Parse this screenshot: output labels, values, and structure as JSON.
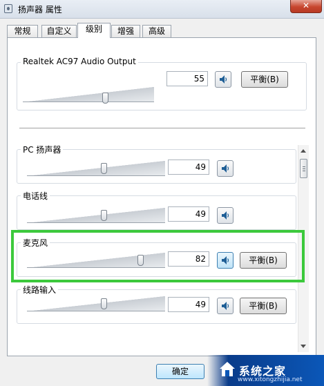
{
  "window": {
    "title": "扬声器 属性",
    "close_label": "✕"
  },
  "tabs": [
    {
      "label": "常规"
    },
    {
      "label": "自定义"
    },
    {
      "label": "级别"
    },
    {
      "label": "增强"
    },
    {
      "label": "高级"
    }
  ],
  "active_tab": "级别",
  "master": {
    "label": "Realtek AC97 Audio Output",
    "value": "55",
    "level": 0.55,
    "balance_label": "平衡(B)"
  },
  "channels": [
    {
      "label": "PC 扬声器",
      "value": "49",
      "level": 0.49,
      "has_balance": false
    },
    {
      "label": "电话线",
      "value": "49",
      "level": 0.49,
      "has_balance": false
    },
    {
      "label": "麦克风",
      "value": "82",
      "level": 0.82,
      "has_balance": true,
      "balance_label": "平衡(B)"
    },
    {
      "label": "线路输入",
      "value": "49",
      "level": 0.49,
      "has_balance": true,
      "balance_label": "平衡(B)"
    }
  ],
  "footer": {
    "ok_label": "确定"
  },
  "watermark": {
    "text": "系统之家",
    "url": "www.xitongzhijia.net"
  },
  "colors": {
    "highlight": "#3cc93c",
    "watermark_blue": "#0b57b8"
  }
}
